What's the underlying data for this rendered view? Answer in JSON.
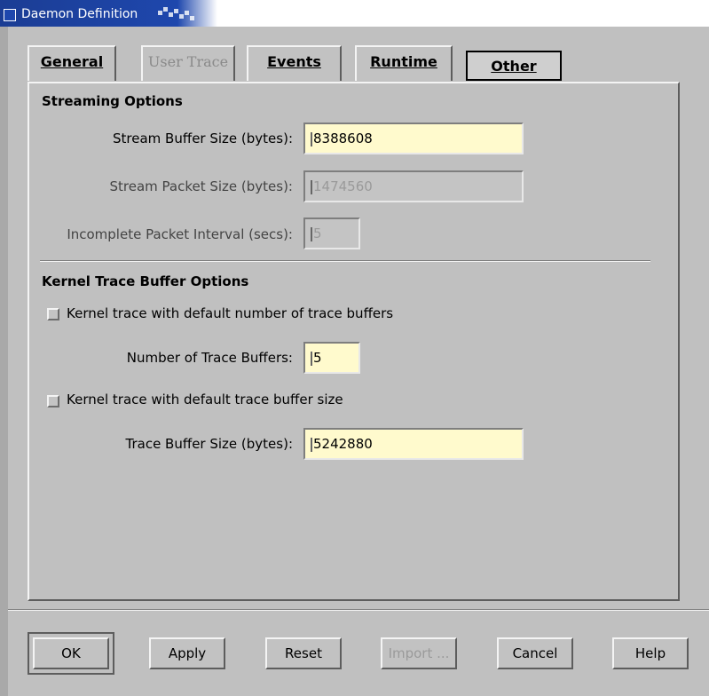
{
  "window": {
    "title": "Daemon Definition"
  },
  "tabs": [
    {
      "label": "General",
      "state": "normal"
    },
    {
      "label": "User Trace",
      "state": "disabled"
    },
    {
      "label": "Events",
      "state": "normal"
    },
    {
      "label": "Runtime",
      "state": "normal"
    },
    {
      "label": "Other",
      "state": "active"
    }
  ],
  "streaming": {
    "title": "Streaming Options",
    "buffer_size": {
      "label": "Stream Buffer Size (bytes):",
      "value": "8388608"
    },
    "packet_size": {
      "label": "Stream Packet Size (bytes):",
      "value": "1474560"
    },
    "packet_interval": {
      "label": "Incomplete Packet Interval (secs):",
      "value": "5"
    }
  },
  "kernel": {
    "title": "Kernel Trace Buffer Options",
    "default_num_check": {
      "label": "Kernel trace with default number of trace buffers",
      "checked": false
    },
    "num_buffers": {
      "label": "Number of Trace Buffers:",
      "value": "5"
    },
    "default_size_check": {
      "label": "Kernel trace with default trace buffer size",
      "checked": false
    },
    "buffer_size": {
      "label": "Trace Buffer Size (bytes):",
      "value": "5242880"
    }
  },
  "buttons": {
    "ok": "OK",
    "apply": "Apply",
    "reset": "Reset",
    "import": "Import ...",
    "cancel": "Cancel",
    "help": "Help"
  },
  "colors": {
    "field_bg": "#fffacd",
    "titlebar": "#1e47ad",
    "window_bg": "#c0c0c0"
  }
}
